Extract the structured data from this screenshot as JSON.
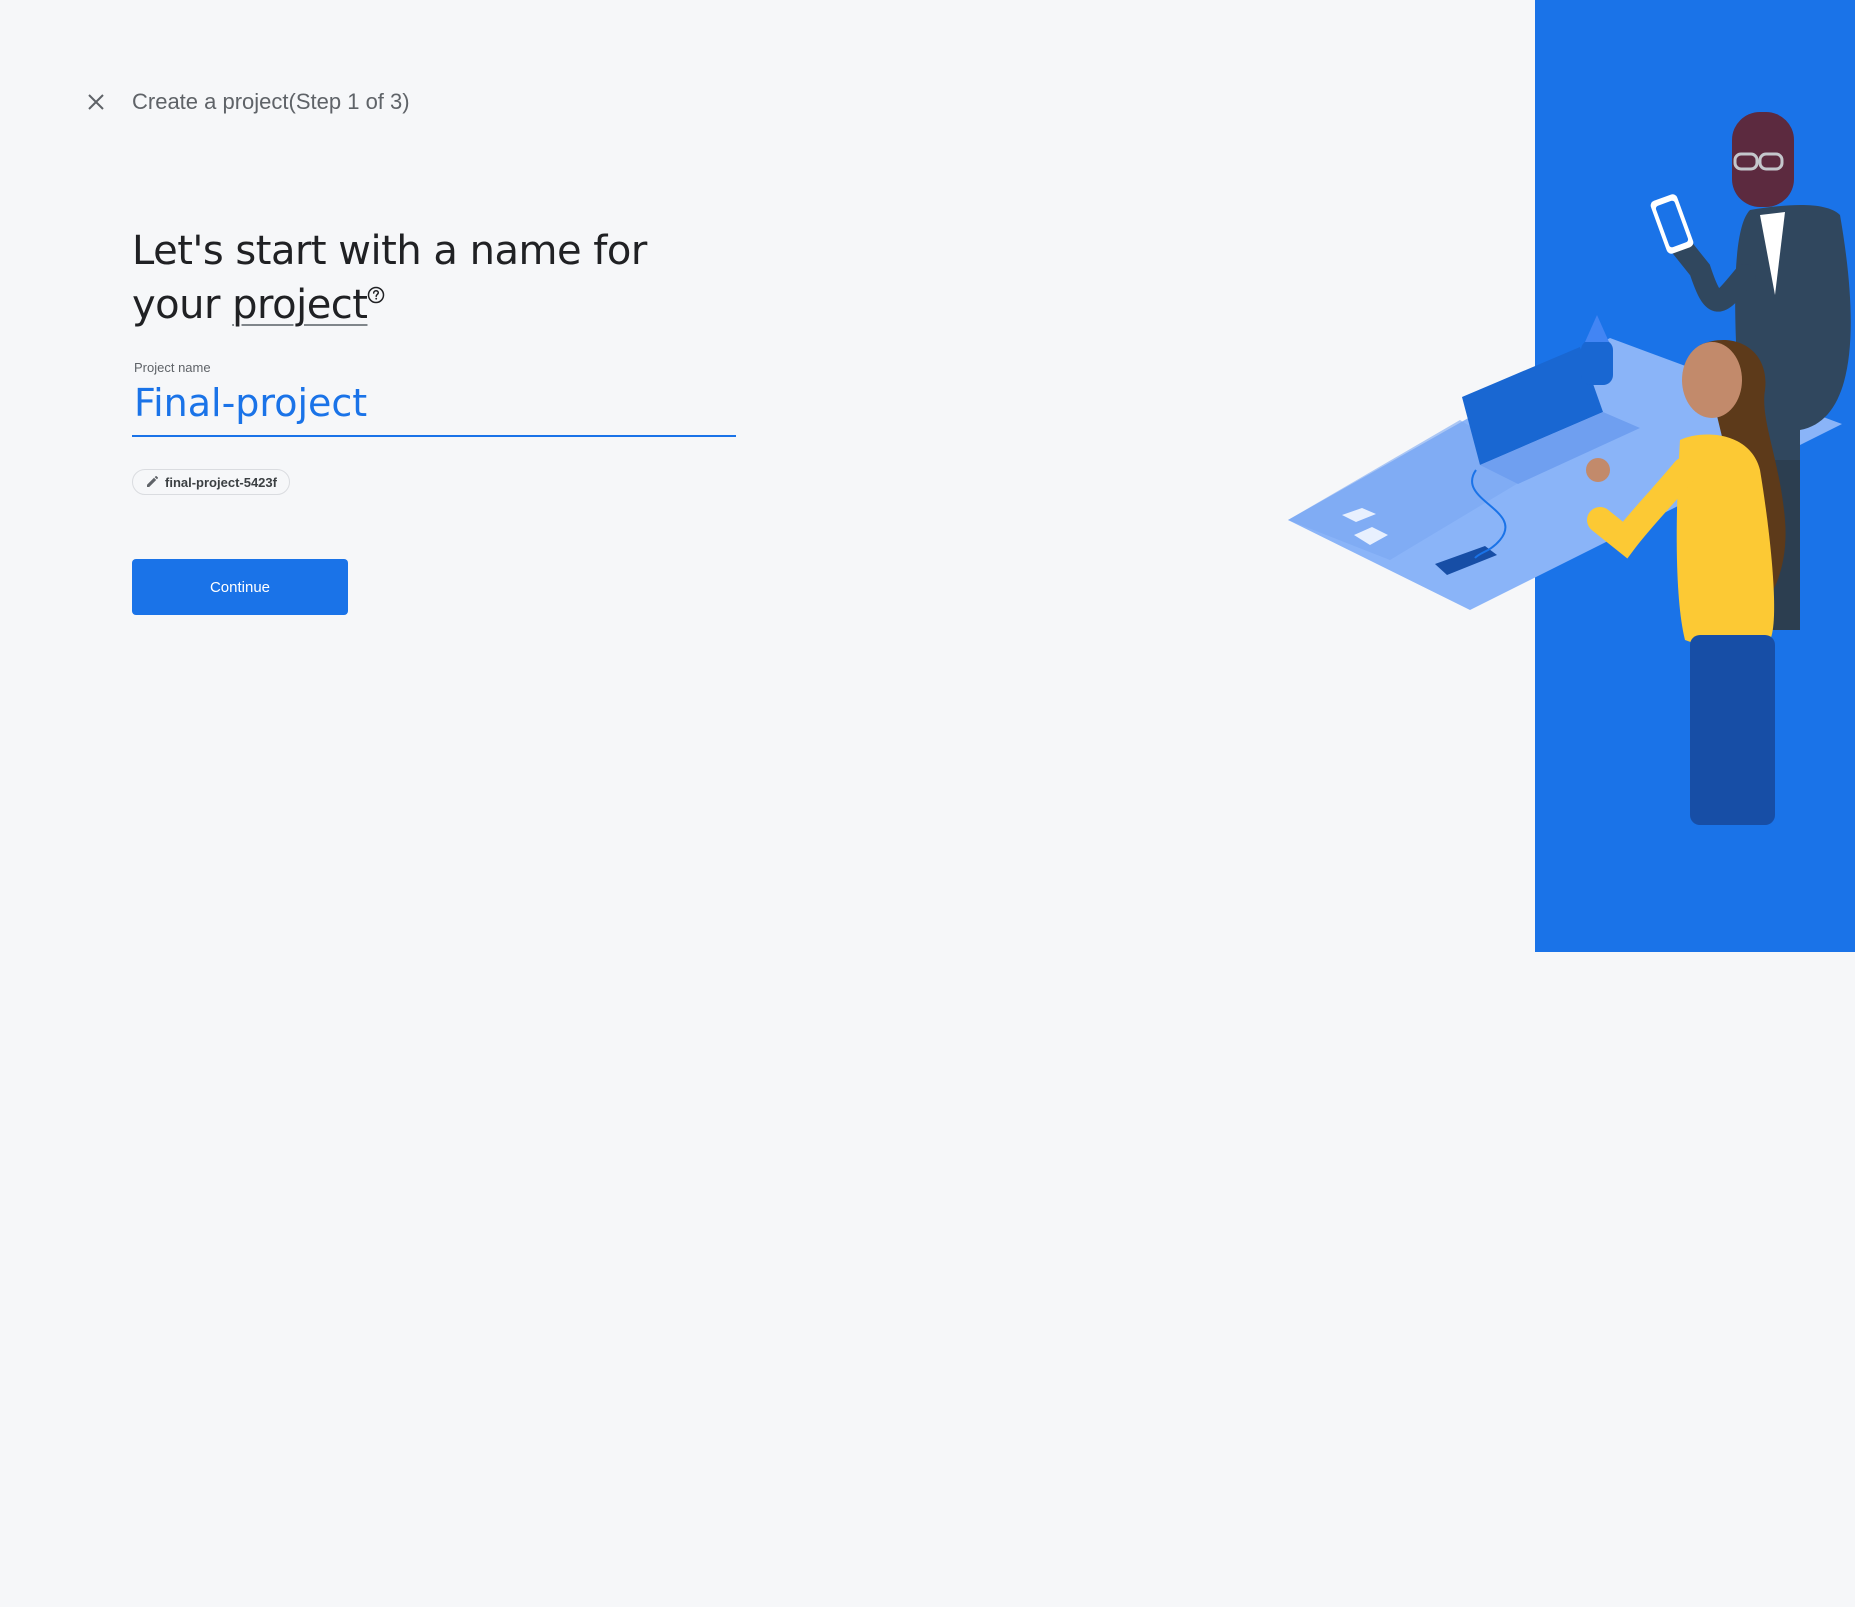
{
  "header": {
    "close_label": "close",
    "step_title": "Create a project(Step 1 of 3)"
  },
  "main": {
    "heading_line1": "Let's start with a name for",
    "heading_line2_prefix": "your ",
    "heading_term": "project",
    "project_name_label": "Project name",
    "project_name_value": "Final-project",
    "project_id": "final-project-5423f",
    "continue_label": "Continue"
  },
  "icons": {
    "close": "close-icon",
    "help": "help-circle-icon",
    "edit": "pencil-icon"
  },
  "colors": {
    "accent": "#1a73e8",
    "background": "#f6f7f9",
    "illustration_panel": "#1a73e8"
  }
}
